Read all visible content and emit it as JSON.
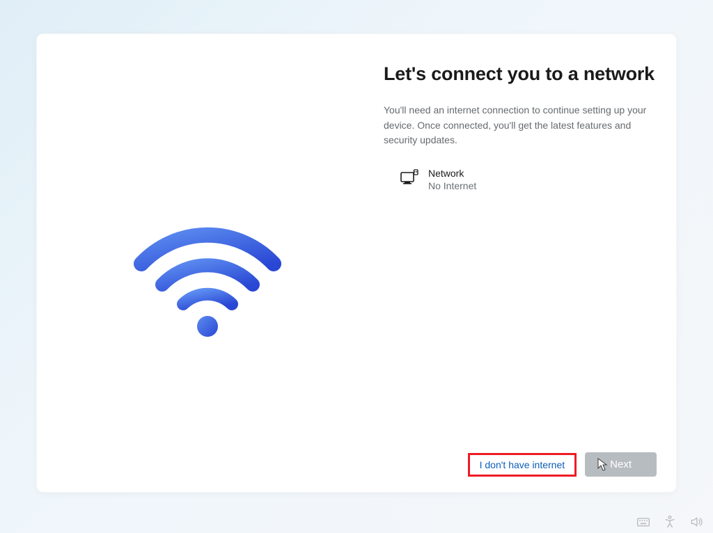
{
  "header": {
    "title": "Let's connect you to a network",
    "description": "You'll need an internet connection to continue setting up your device. Once connected, you'll get the latest features and security updates."
  },
  "network_item": {
    "name": "Network",
    "status": "No Internet"
  },
  "buttons": {
    "no_internet_label": "I don't have internet",
    "next_label": "Next"
  },
  "colors": {
    "accent_blue_light": "#4f7ae8",
    "accent_blue_dark": "#2a4cd3",
    "highlight_red": "#ee1b24"
  }
}
